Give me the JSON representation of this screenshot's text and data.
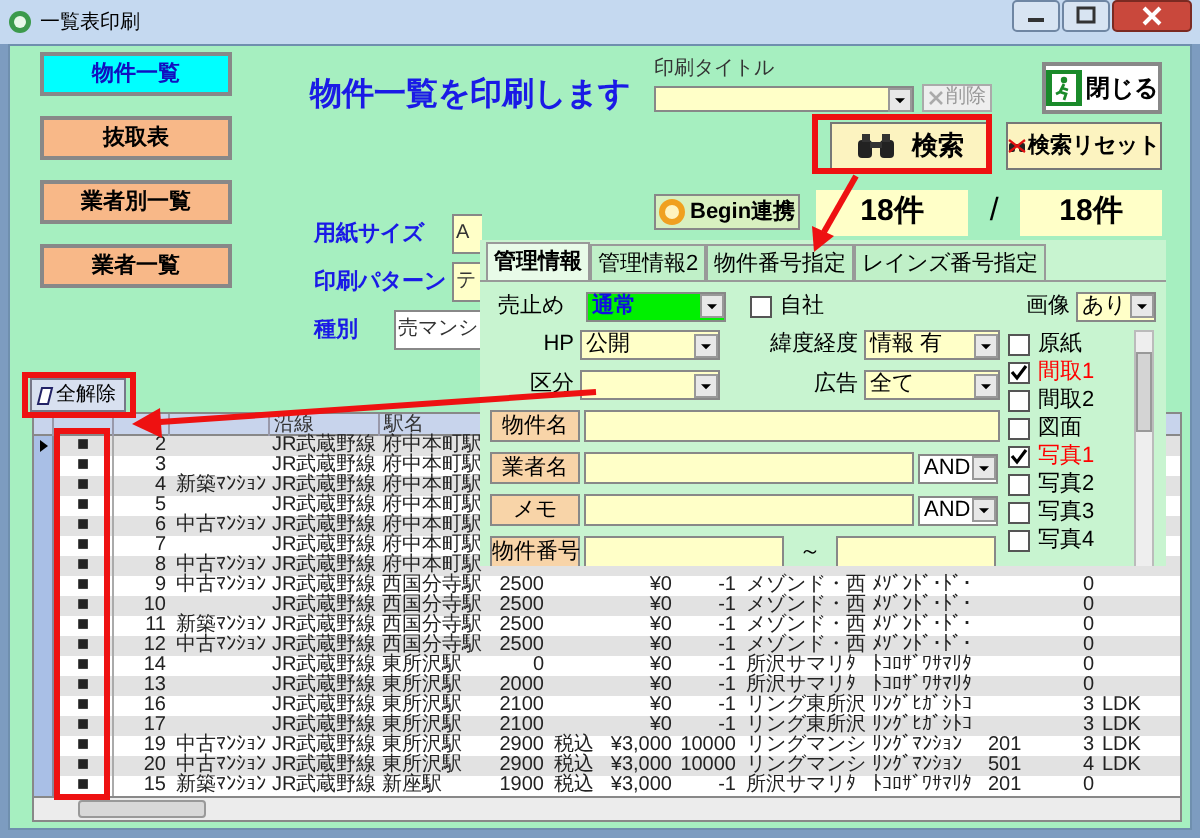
{
  "window": {
    "title": "一覧表印刷"
  },
  "nav_buttons": [
    {
      "label": "物件一覧",
      "selected": true
    },
    {
      "label": "抜取表",
      "selected": false
    },
    {
      "label": "業者別一覧",
      "selected": false
    },
    {
      "label": "業者一覧",
      "selected": false
    }
  ],
  "heading": "物件一覧を印刷します",
  "print_title": {
    "label": "印刷タイトル",
    "delete_button": "削除"
  },
  "close_button": "閉じる",
  "search_button": "検索",
  "reset_button": "検索リセット",
  "begin_button": "Begin連携",
  "counts": [
    "18件",
    "18件"
  ],
  "count_separator": "/",
  "fields": [
    {
      "label": "用紙サイズ",
      "value": "A"
    },
    {
      "label": "印刷パターン",
      "value": "テ"
    },
    {
      "label": "種別",
      "value": "売マンシ"
    }
  ],
  "clear_all_button": "全解除",
  "table": {
    "columns": [
      "沿線",
      "駅名"
    ],
    "rows": [
      {
        "selected": true,
        "mark": "■",
        "no": "2",
        "line": "JR武蔵野線",
        "station": "府中本町駅"
      },
      {
        "selected": false,
        "mark": "■",
        "no": "3",
        "line": "JR武蔵野線",
        "station": "府中本町駅"
      },
      {
        "selected": false,
        "mark": "■",
        "no": "4",
        "type": "新築ﾏﾝｼｮﾝ",
        "line": "JR武蔵野線",
        "station": "府中本町駅"
      },
      {
        "selected": false,
        "mark": "■",
        "no": "5",
        "line": "JR武蔵野線",
        "station": "府中本町駅"
      },
      {
        "selected": false,
        "mark": "■",
        "no": "6",
        "type": "中古ﾏﾝｼｮﾝ",
        "line": "JR武蔵野線",
        "station": "府中本町駅"
      },
      {
        "selected": false,
        "mark": "■",
        "no": "7",
        "line": "JR武蔵野線",
        "station": "府中本町駅"
      },
      {
        "selected": false,
        "mark": "■",
        "no": "8",
        "type": "中古ﾏﾝｼｮﾝ",
        "line": "JR武蔵野線",
        "station": "府中本町駅"
      },
      {
        "selected": false,
        "mark": "■",
        "no": "9",
        "type": "中古ﾏﾝｼｮﾝ",
        "line": "JR武蔵野線",
        "station": "西国分寺駅",
        "price": "2500",
        "amount": "¥0",
        "code": "-1",
        "building": "メゾンド・西",
        "kana": "ﾒｿﾞﾝﾄﾞ･ﾄﾞ･",
        "rooms": "0"
      },
      {
        "selected": false,
        "mark": "■",
        "no": "10",
        "line": "JR武蔵野線",
        "station": "西国分寺駅",
        "price": "2500",
        "amount": "¥0",
        "code": "-1",
        "building": "メゾンド・西",
        "kana": "ﾒｿﾞﾝﾄﾞ･ﾄﾞ･",
        "rooms": "0"
      },
      {
        "selected": false,
        "mark": "■",
        "no": "11",
        "type": "新築ﾏﾝｼｮﾝ",
        "line": "JR武蔵野線",
        "station": "西国分寺駅",
        "price": "2500",
        "amount": "¥0",
        "code": "-1",
        "building": "メゾンド・西",
        "kana": "ﾒｿﾞﾝﾄﾞ･ﾄﾞ･",
        "rooms": "0"
      },
      {
        "selected": false,
        "mark": "■",
        "no": "12",
        "type": "中古ﾏﾝｼｮﾝ",
        "line": "JR武蔵野線",
        "station": "西国分寺駅",
        "price": "2500",
        "amount": "¥0",
        "code": "-1",
        "building": "メゾンド・西",
        "kana": "ﾒｿﾞﾝﾄﾞ･ﾄﾞ･",
        "rooms": "0"
      },
      {
        "selected": false,
        "mark": "■",
        "no": "14",
        "line": "JR武蔵野線",
        "station": "東所沢駅",
        "price": "0",
        "amount": "¥0",
        "code": "-1",
        "building": "所沢サマリﾀ",
        "kana": "ﾄｺﾛｻﾞﾜｻﾏﾘﾀ",
        "rooms": "0"
      },
      {
        "selected": false,
        "mark": "■",
        "no": "13",
        "line": "JR武蔵野線",
        "station": "東所沢駅",
        "price": "2000",
        "amount": "¥0",
        "code": "-1",
        "building": "所沢サマリﾀ",
        "kana": "ﾄｺﾛｻﾞﾜｻﾏﾘﾀ",
        "rooms": "0"
      },
      {
        "selected": false,
        "mark": "■",
        "no": "16",
        "line": "JR武蔵野線",
        "station": "東所沢駅",
        "price": "2100",
        "amount": "¥0",
        "code": "-1",
        "building": "リング東所沢",
        "kana": "ﾘﾝｸﾞﾋｶﾞｼﾄｺ",
        "rooms": "3",
        "layout": "LDK"
      },
      {
        "selected": false,
        "mark": "■",
        "no": "17",
        "line": "JR武蔵野線",
        "station": "東所沢駅",
        "price": "2100",
        "amount": "¥0",
        "code": "-1",
        "building": "リング東所沢",
        "kana": "ﾘﾝｸﾞﾋｶﾞｼﾄｺ",
        "rooms": "3",
        "layout": "LDK"
      },
      {
        "selected": false,
        "mark": "■",
        "no": "19",
        "type": "中古ﾏﾝｼｮﾝ",
        "line": "JR武蔵野線",
        "station": "東所沢駅",
        "price": "2900",
        "tax": "税込",
        "amount": "¥3,000",
        "code": "10000",
        "building": "リングマンシ",
        "kana": "ﾘﾝｸﾞﾏﾝｼｮﾝ",
        "room": "201",
        "rooms": "3",
        "layout": "LDK"
      },
      {
        "selected": false,
        "mark": "■",
        "no": "20",
        "type": "中古ﾏﾝｼｮﾝ",
        "line": "JR武蔵野線",
        "station": "東所沢駅",
        "price": "2900",
        "tax": "税込",
        "amount": "¥3,000",
        "code": "10000",
        "building": "リングマンシ",
        "kana": "ﾘﾝｸﾞﾏﾝｼｮﾝ",
        "room": "501",
        "rooms": "4",
        "layout": "LDK"
      },
      {
        "selected": false,
        "mark": "■",
        "no": "15",
        "type": "新築ﾏﾝｼｮﾝ",
        "line": "JR武蔵野線",
        "station": "新座駅",
        "price": "1900",
        "tax": "税込",
        "amount": "¥3,000",
        "code": "-1",
        "building": "所沢サマリﾀ",
        "kana": "ﾄｺﾛｻﾞﾜｻﾏﾘﾀ",
        "room": "201",
        "rooms": "0"
      }
    ]
  },
  "filter_panel": {
    "tabs": [
      {
        "label": "管理情報",
        "selected": true
      },
      {
        "label": "管理情報2",
        "selected": false
      },
      {
        "label": "物件番号指定",
        "selected": false
      },
      {
        "label": "レインズ番号指定",
        "selected": false
      }
    ],
    "stop": {
      "label": "売止め",
      "value": "通常"
    },
    "own": {
      "label": "自社",
      "checked": false
    },
    "image": {
      "label": "画像",
      "value": "あり"
    },
    "hp": {
      "label": "HP",
      "value": "公開"
    },
    "latlng": {
      "label": "緯度経度",
      "value": "情報 有"
    },
    "section": {
      "label": "区分"
    },
    "ad": {
      "label": "広告",
      "value": "全て"
    },
    "text_fields": [
      {
        "label": "物件名"
      },
      {
        "label": "業者名",
        "operator": "AND"
      },
      {
        "label": "メモ",
        "operator": "AND"
      }
    ],
    "number_range": {
      "label": "物件番号",
      "separator": "～"
    },
    "checklist": [
      {
        "label": "原紙",
        "checked": false
      },
      {
        "label": "間取1",
        "checked": true
      },
      {
        "label": "間取2",
        "checked": false
      },
      {
        "label": "図面",
        "checked": false
      },
      {
        "label": "写真1",
        "checked": true
      },
      {
        "label": "写真2",
        "checked": false
      },
      {
        "label": "写真3",
        "checked": false
      },
      {
        "label": "写真4",
        "checked": false
      }
    ]
  }
}
